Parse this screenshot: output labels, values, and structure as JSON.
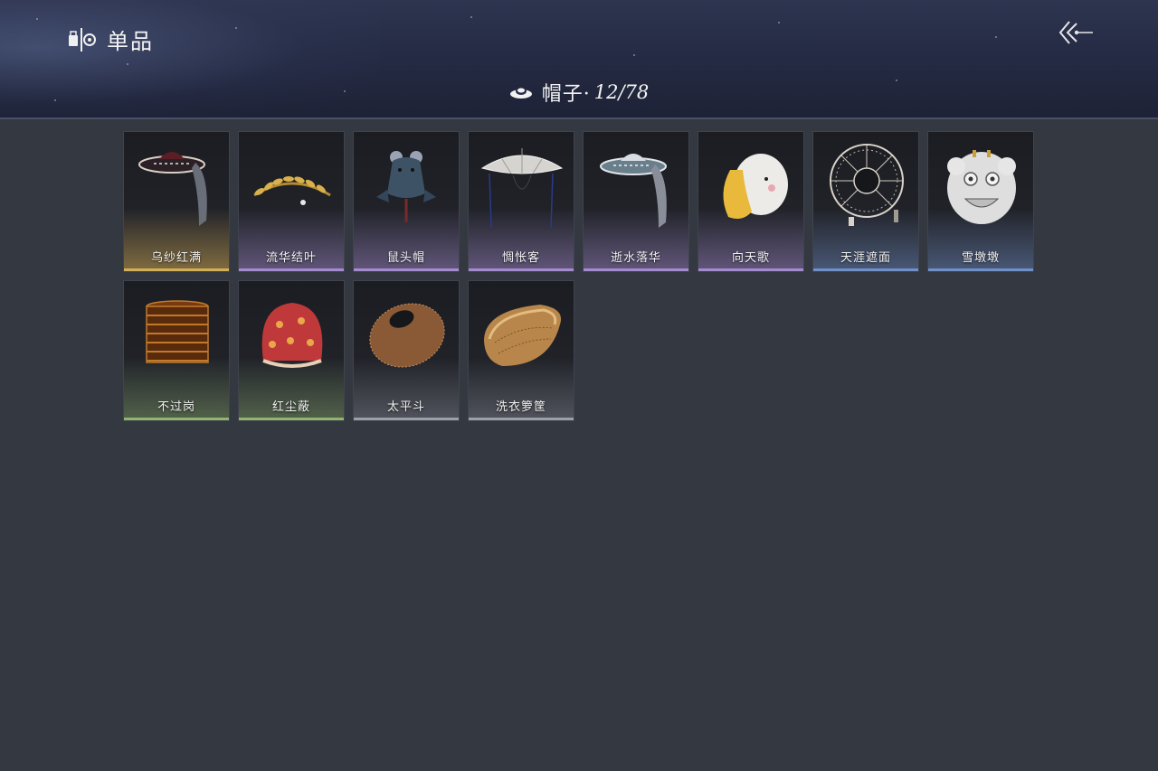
{
  "header": {
    "title": "单品",
    "back_icon": "double-chevron-left-icon"
  },
  "category": {
    "icon": "hat-icon",
    "label": "帽子·",
    "count": "12/78"
  },
  "items": [
    {
      "name": "乌纱红满",
      "rarity_color": "#c9a24a"
    },
    {
      "name": "流华结叶",
      "rarity_color": "#a48bd0"
    },
    {
      "name": "鼠头帽",
      "rarity_color": "#a48bd0"
    },
    {
      "name": "惆怅客",
      "rarity_color": "#a48bd0"
    },
    {
      "name": "逝水落华",
      "rarity_color": "#a48bd0"
    },
    {
      "name": "向天歌",
      "rarity_color": "#a48bd0"
    },
    {
      "name": "天涯遮面",
      "rarity_color": "#6f90c8"
    },
    {
      "name": "雪墩墩",
      "rarity_color": "#6f90c8"
    },
    {
      "name": "不过岗",
      "rarity_color": "#8fb56e"
    },
    {
      "name": "红尘蔽",
      "rarity_color": "#8fb56e"
    },
    {
      "name": "太平斗",
      "rarity_color": "#9aa0aa"
    },
    {
      "name": "洗衣箩筐",
      "rarity_color": "#9aa0aa"
    }
  ]
}
